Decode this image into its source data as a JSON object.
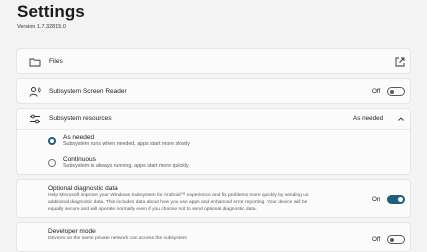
{
  "header": {
    "title": "Settings",
    "version": "Version 1.7.32815.0"
  },
  "files": {
    "label": "Files",
    "icon": "folder-icon",
    "action_icon": "open-external-icon"
  },
  "screen_reader": {
    "label": "Subsystem Screen Reader",
    "icon": "person-sound-icon",
    "state_label": "Off",
    "enabled": false
  },
  "resources": {
    "label": "Subsystem resources",
    "icon": "sliders-icon",
    "selected_value": "As needed",
    "expanded": true,
    "options": [
      {
        "title": "As needed",
        "description": "Subsystem runs when needed, apps start more slowly",
        "selected": true
      },
      {
        "title": "Continuous",
        "description": "Subsystem is always running, apps start more quickly",
        "selected": false
      }
    ]
  },
  "diagnostic": {
    "label": "Optional diagnostic data",
    "description_line1": "Help Microsoft improve your Windows Subsystem for Android™ experience and fix problems more quickly by sending us",
    "description_line2": "additional diagnostic data. This includes data about how you use apps and enhanced error reporting. Your device will be",
    "description_line3": "equally secure and will operate normally even if you choose not to send optional diagnostic data.",
    "state_label": "On",
    "enabled": true,
    "accent": "#1f5f7a"
  },
  "developer": {
    "label": "Developer mode",
    "description": "Devices on the same private network can access the subsystem",
    "state_label": "Off",
    "enabled": false
  }
}
